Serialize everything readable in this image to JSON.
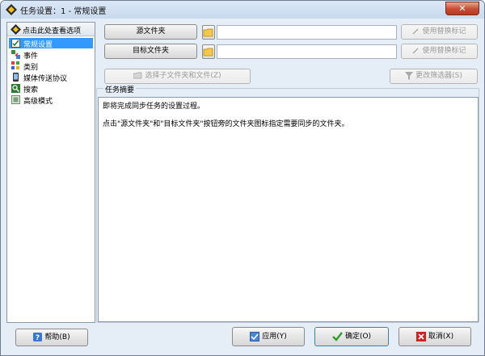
{
  "window": {
    "title": "任务设置：1 - 常规设置",
    "close_label": "✕"
  },
  "sidebar": {
    "header": "点击此处查看选项",
    "items": [
      {
        "label": "常规设置",
        "icon": "general-settings-icon",
        "selected": true
      },
      {
        "label": "事件",
        "icon": "events-icon"
      },
      {
        "label": "类别",
        "icon": "categories-icon"
      },
      {
        "label": "媒体传送协议",
        "icon": "mtp-icon"
      },
      {
        "label": "搜索",
        "icon": "search-icon"
      },
      {
        "label": "高级模式",
        "icon": "advanced-icon"
      }
    ]
  },
  "source": {
    "button": "源文件夹",
    "path": "",
    "replace_label": "使用替换标记"
  },
  "target": {
    "button": "目标文件夹",
    "path": "",
    "replace_label": "使用替换标记"
  },
  "select_subfolders": "选择子文件夹和文件(Z)",
  "change_filter": "更改筛选器(S)",
  "summary": {
    "label": "任务摘要",
    "line1": "即将完成同步任务的设置过程。",
    "line2": "点击\"源文件夹\"和\"目标文件夹\"按钮旁的文件夹图标指定需要同步的文件夹。"
  },
  "footer": {
    "help": "帮助(B)",
    "apply": "应用(Y)",
    "ok": "确定(O)",
    "cancel": "取消(X)"
  },
  "colors": {
    "selected": "#3399ff",
    "window_bg": "#e5edf7",
    "ok_check": "#2e9c2e",
    "cancel_x": "#d02020"
  }
}
